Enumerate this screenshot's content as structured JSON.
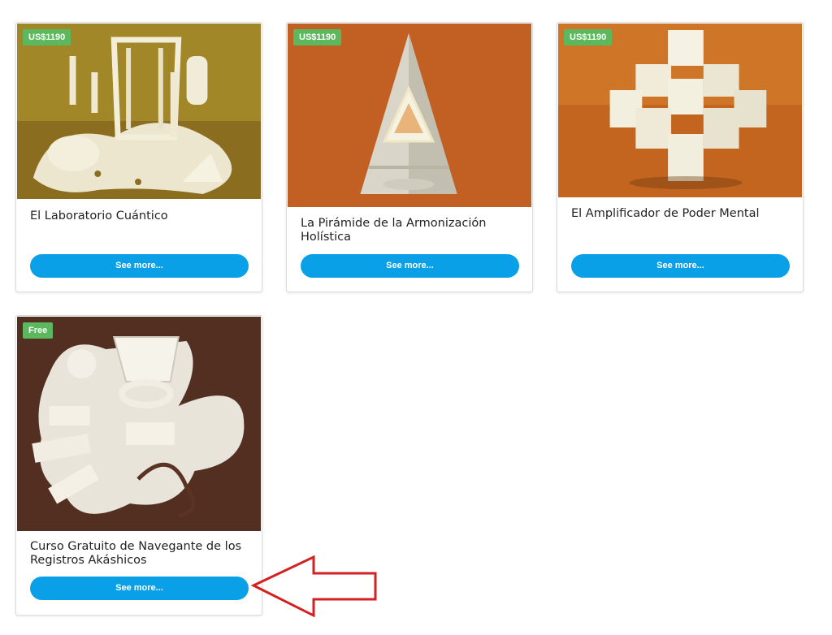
{
  "products": [
    {
      "badge": "US$1190",
      "title": "El Laboratorio Cuántico",
      "button_label": "See more..."
    },
    {
      "badge": "US$1190",
      "title": "La Pirámide de la Armonización Holística",
      "button_label": "See more..."
    },
    {
      "badge": "US$1190",
      "title": "El Amplificador de Poder Mental",
      "button_label": "See more..."
    },
    {
      "badge": "Free",
      "title": "Curso Gratuito de Navegante de los Registros Akáshicos",
      "button_label": "See more..."
    }
  ],
  "colors": {
    "badge": "#5cb85c",
    "button": "#0aa0e8",
    "arrow": "#d42020"
  }
}
